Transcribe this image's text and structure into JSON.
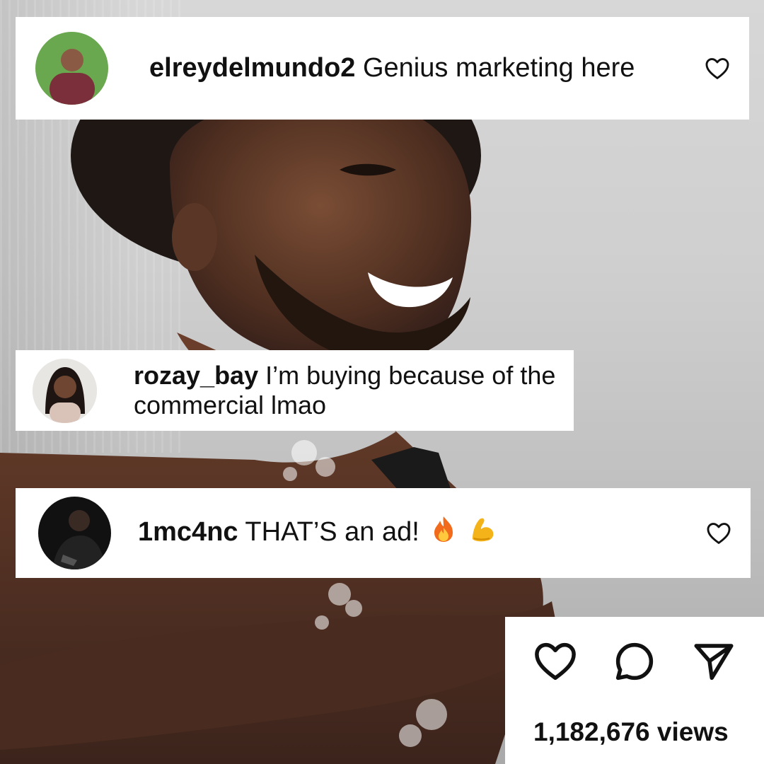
{
  "comments": [
    {
      "username": "elreydelmundo2",
      "text": "Genius marketing here",
      "avatar_icon": "profile-photo",
      "has_like": true
    },
    {
      "username": "rozay_bay",
      "text": "I’m buying because of the commercial lmao",
      "avatar_icon": "profile-photo",
      "has_like": false
    },
    {
      "username": "1mc4nc",
      "text": "THAT’S an ad!",
      "emojis": [
        "fire-emoji",
        "flexed-biceps-emoji"
      ],
      "avatar_icon": "profile-photo",
      "has_like": true
    }
  ],
  "actions": {
    "icons": [
      "heart-icon",
      "comment-icon",
      "share-icon"
    ],
    "views": "1,182,676 views"
  },
  "colors": {
    "card_bg": "#ffffff",
    "text": "#111111",
    "background_gray": "#cfcfcf"
  }
}
